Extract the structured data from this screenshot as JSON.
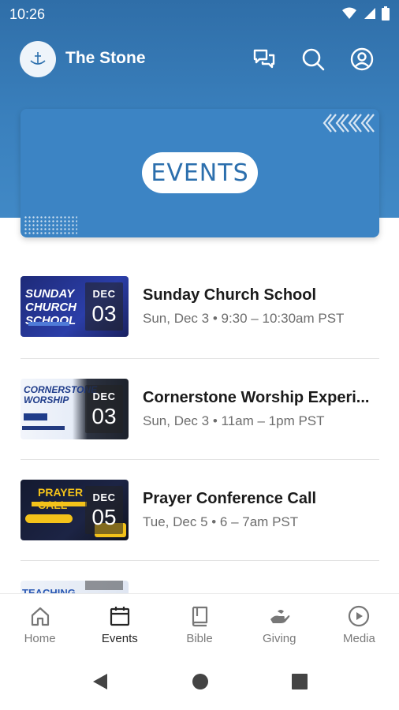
{
  "status": {
    "time": "10:26"
  },
  "app": {
    "title": "The Stone"
  },
  "banner": {
    "label": "EVENTS"
  },
  "events": [
    {
      "title": "Sunday Church School",
      "subtitle": "Sun, Dec 3 • 9:30 – 10:30am PST",
      "month": "DEC",
      "day": "03",
      "thumb_text": "SUNDAY CHURCH SCHOOL"
    },
    {
      "title": "Cornerstone Worship Experi...",
      "subtitle": "Sun, Dec 3 • 11am – 1pm PST",
      "month": "DEC",
      "day": "03",
      "thumb_text": "CORNERSTONE WORSHIP"
    },
    {
      "title": "Prayer Conference Call",
      "subtitle": "Tue, Dec 5 • 6 – 7am PST",
      "month": "DEC",
      "day": "05",
      "thumb_text": "PRAYER CALL"
    }
  ],
  "partial_event": {
    "thumb_text": "TEACHING"
  },
  "nav": [
    {
      "label": "Home",
      "icon": "home-icon"
    },
    {
      "label": "Events",
      "icon": "calendar-icon"
    },
    {
      "label": "Bible",
      "icon": "book-icon"
    },
    {
      "label": "Giving",
      "icon": "giving-hand-icon"
    },
    {
      "label": "Media",
      "icon": "play-circle-icon"
    }
  ],
  "colors": {
    "header": "#3a80bd",
    "banner": "#3c84c4",
    "accent": "#2c6fad"
  }
}
